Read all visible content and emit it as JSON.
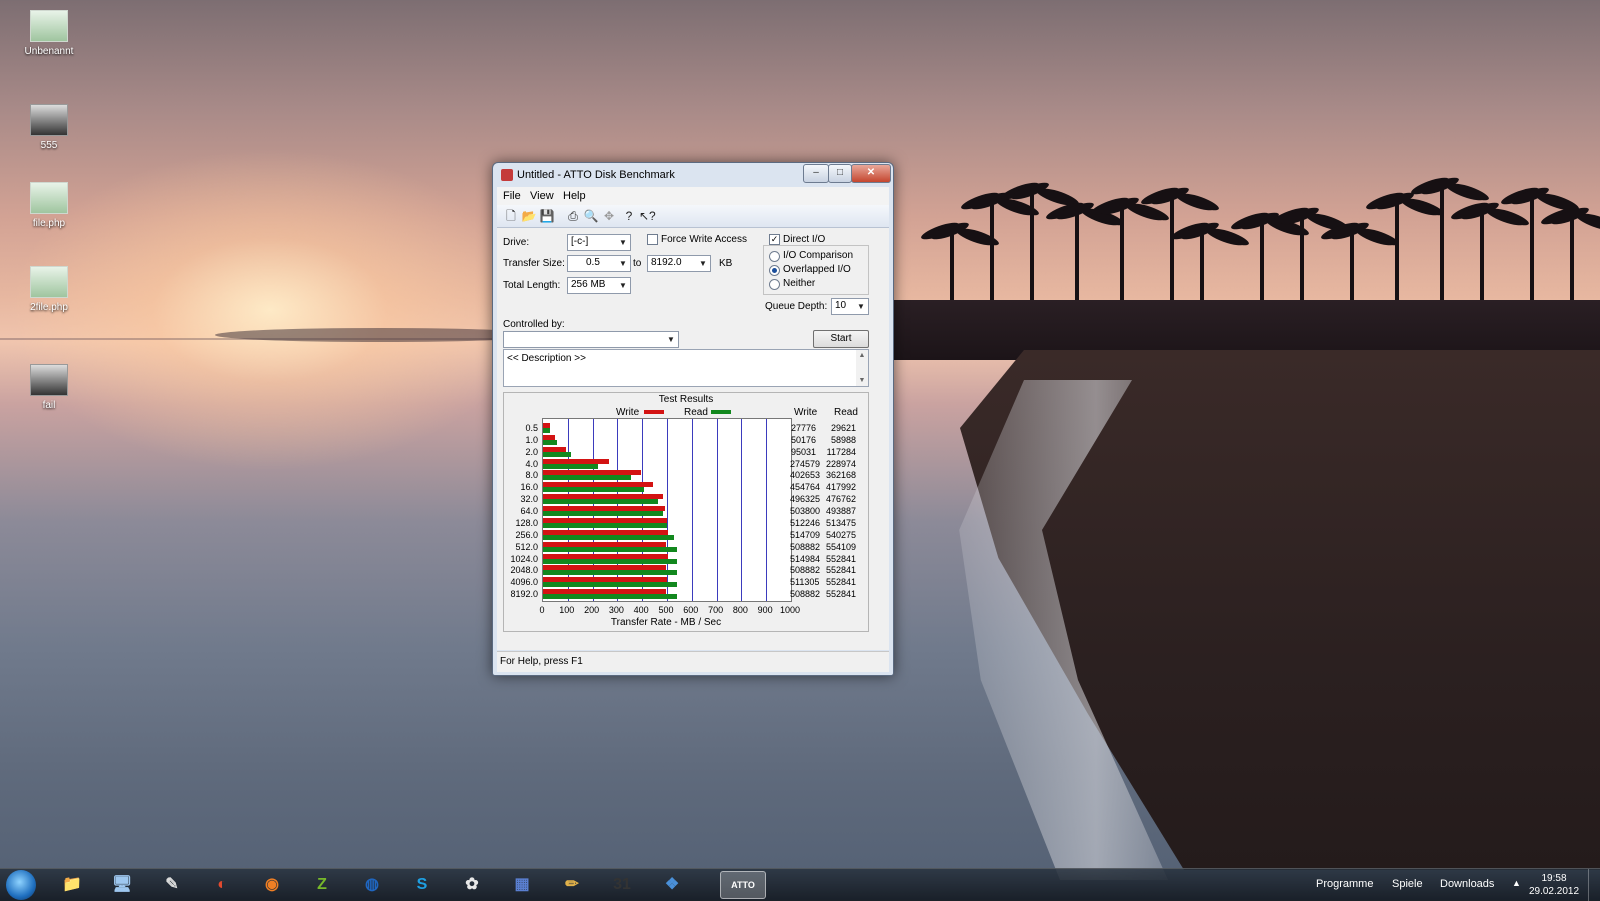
{
  "desktop": {
    "icons": [
      {
        "label": "Unbenannt"
      },
      {
        "label": "555"
      },
      {
        "label": "file.php"
      },
      {
        "label": "2file.php"
      },
      {
        "label": "fail"
      }
    ]
  },
  "window": {
    "title": "Untitled - ATTO Disk Benchmark",
    "controls": {
      "minimize": "–",
      "maximize": "□",
      "close": "✕"
    },
    "menu": [
      "File",
      "View",
      "Help"
    ],
    "toolbar_icons": [
      "new-icon",
      "open-icon",
      "save-icon",
      "print-icon",
      "print-preview-icon",
      "move-icon",
      "help-icon",
      "context-help-icon"
    ],
    "status": "For Help, press F1"
  },
  "form": {
    "drive_label": "Drive:",
    "drive_value": "[-c-]",
    "force_write_label": "Force Write Access",
    "force_write_checked": false,
    "direct_io_label": "Direct I/O",
    "direct_io_checked": true,
    "transfer_size_label": "Transfer Size:",
    "transfer_from": "0.5",
    "to_label": "to",
    "transfer_to": "8192.0",
    "kb_label": "KB",
    "total_length_label": "Total Length:",
    "total_length_value": "256 MB",
    "radio_io_comparison": "I/O Comparison",
    "radio_overlapped": "Overlapped I/O",
    "radio_neither": "Neither",
    "selected_mode": "Overlapped I/O",
    "queue_depth_label": "Queue Depth:",
    "queue_depth_value": "10",
    "controlled_by_label": "Controlled by:",
    "controlled_by_value": "",
    "start_button": "Start",
    "description": "<< Description >>"
  },
  "chart_data": {
    "type": "bar",
    "title": "Test Results",
    "xlabel": "Transfer Rate - MB / Sec",
    "xlim": [
      0,
      1000
    ],
    "x_ticks": [
      "0",
      "100",
      "200",
      "300",
      "400",
      "500",
      "600",
      "700",
      "800",
      "900",
      "1000"
    ],
    "legend": [
      {
        "name": "Write",
        "color": "#d31313"
      },
      {
        "name": "Read",
        "color": "#12881e"
      }
    ],
    "columns": [
      "Write",
      "Read"
    ],
    "categories": [
      "0.5",
      "1.0",
      "2.0",
      "4.0",
      "8.0",
      "16.0",
      "32.0",
      "64.0",
      "128.0",
      "256.0",
      "512.0",
      "1024.0",
      "2048.0",
      "4096.0",
      "8192.0"
    ],
    "series": [
      {
        "name": "Write",
        "values": [
          27776,
          50176,
          95031,
          274579,
          402653,
          454764,
          496325,
          503800,
          512246,
          514709,
          508882,
          514984,
          508882,
          511305,
          508882
        ]
      },
      {
        "name": "Read",
        "values": [
          29621,
          58988,
          117284,
          228974,
          362168,
          417992,
          476762,
          493887,
          513475,
          540275,
          554109,
          552841,
          552841,
          552841,
          552841
        ]
      }
    ]
  },
  "taskbar": {
    "apps": [
      {
        "name": "explorer-icon",
        "glyph": "📁"
      },
      {
        "name": "network-icon",
        "glyph": "🖥"
      },
      {
        "name": "app-icon",
        "glyph": "✎"
      },
      {
        "name": "opera-icon",
        "glyph": "◐"
      },
      {
        "name": "firefox-icon",
        "glyph": "◉"
      },
      {
        "name": "z-app-icon",
        "glyph": "Z"
      },
      {
        "name": "globe-icon",
        "glyph": "◍"
      },
      {
        "name": "skype-icon",
        "glyph": "S"
      },
      {
        "name": "picasa-icon",
        "glyph": "✿"
      },
      {
        "name": "paint-icon",
        "glyph": "▦"
      },
      {
        "name": "pencil-icon",
        "glyph": "✏"
      },
      {
        "name": "calendar-icon",
        "glyph": "31"
      },
      {
        "name": "game-icon",
        "glyph": "❖"
      },
      {
        "name": "atto-icon",
        "glyph": "ATTO"
      }
    ],
    "tray": [
      "Programme",
      "Spiele",
      "Downloads"
    ],
    "time": "19:58",
    "date": "29.02.2012"
  }
}
